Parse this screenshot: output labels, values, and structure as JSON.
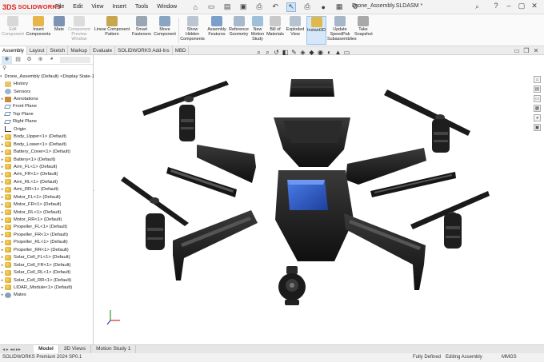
{
  "app": {
    "logo_prefix": "3DS",
    "logo_text": "SOLIDWORKS",
    "document_title": "Drone_Assembly.SLDASM *"
  },
  "menu": [
    "File",
    "Edit",
    "View",
    "Insert",
    "Tools",
    "Window"
  ],
  "ribbon": [
    {
      "label": "Edit Component",
      "disabled": true
    },
    {
      "label": "Insert Components"
    },
    {
      "label": "Mate"
    },
    {
      "label": "Component Preview Window",
      "disabled": true
    },
    {
      "label": "Linear Component Pattern"
    },
    {
      "label": "Smart Fasteners"
    },
    {
      "label": "Move Component"
    },
    {
      "label": "Show Hidden Components"
    },
    {
      "label": "Assembly Features"
    },
    {
      "label": "Reference Geometry"
    },
    {
      "label": "New Motion Study"
    },
    {
      "label": "Bill of Materials"
    },
    {
      "label": "Exploded View"
    },
    {
      "label": "Instant3D",
      "active": true
    },
    {
      "label": "Update SpeedPak Subassemblies"
    },
    {
      "label": "Take Snapshot"
    }
  ],
  "command_tabs": [
    "Assembly",
    "Layout",
    "Sketch",
    "Markup",
    "Evaluate",
    "SOLIDWORKS Add-Ins",
    "MBD"
  ],
  "active_command_tab": "Assembly",
  "tree": {
    "root": "Drone_Assembly (Default) <Display State-1>",
    "items": [
      {
        "label": "History",
        "icon": "folder"
      },
      {
        "label": "Sensors",
        "icon": "sensor"
      },
      {
        "label": "Annotations",
        "icon": "anno",
        "expand": true
      },
      {
        "label": "Front Plane",
        "icon": "plane"
      },
      {
        "label": "Top Plane",
        "icon": "plane"
      },
      {
        "label": "Right Plane",
        "icon": "plane"
      },
      {
        "label": "Origin",
        "icon": "origin"
      },
      {
        "label": "Body_Upper<1> (Default)",
        "icon": "part",
        "expand": true
      },
      {
        "label": "Body_Lower<1> (Default)",
        "icon": "part",
        "expand": true
      },
      {
        "label": "Battery_Cover<1> (Default)",
        "icon": "part",
        "expand": true
      },
      {
        "label": "Battery<1> (Default)",
        "icon": "part",
        "expand": true
      },
      {
        "label": "Arm_FL<1> (Default)",
        "icon": "part",
        "expand": true
      },
      {
        "label": "Arm_FR<1> (Default)",
        "icon": "part",
        "expand": true
      },
      {
        "label": "Arm_RL<1> (Default)",
        "icon": "part",
        "expand": true
      },
      {
        "label": "Arm_RR<1> (Default)",
        "icon": "part",
        "expand": true
      },
      {
        "label": "Motor_FL<1> (Default)",
        "icon": "part",
        "expand": true
      },
      {
        "label": "Motor_FR<1> (Default)",
        "icon": "part",
        "expand": true
      },
      {
        "label": "Motor_RL<1> (Default)",
        "icon": "part",
        "expand": true
      },
      {
        "label": "Motor_RR<1> (Default)",
        "icon": "part",
        "expand": true
      },
      {
        "label": "Propeller_FL<1> (Default)",
        "icon": "part",
        "expand": true
      },
      {
        "label": "Propeller_FR<1> (Default)",
        "icon": "part",
        "expand": true
      },
      {
        "label": "Propeller_RL<1> (Default)",
        "icon": "part",
        "expand": true
      },
      {
        "label": "Propeller_RR<1> (Default)",
        "icon": "part",
        "expand": true
      },
      {
        "label": "Solar_Cell_FL<1> (Default)",
        "icon": "part",
        "expand": true
      },
      {
        "label": "Solar_Cell_FR<1> (Default)",
        "icon": "part",
        "expand": true
      },
      {
        "label": "Solar_Cell_RL<1> (Default)",
        "icon": "part",
        "expand": true
      },
      {
        "label": "Solar_Cell_RR<1> (Default)",
        "icon": "part",
        "expand": true
      },
      {
        "label": "LIDAR_Module<1> (Default)",
        "icon": "part",
        "expand": true
      },
      {
        "label": "Mates",
        "icon": "mate",
        "expand": true
      }
    ]
  },
  "bottom_tabs": [
    "Model",
    "3D Views",
    "Motion Study 1"
  ],
  "active_bottom_tab": "Model",
  "status": {
    "version": "SOLIDWORKS Premium 2024 SP0.1",
    "defined": "Fully Defined",
    "mode": "Editing Assembly",
    "units": "MMGS"
  },
  "colors": {
    "brand": "#d9241c",
    "battery": "#2b5fcf",
    "part": "#1c1c1c",
    "solar": "#6b6b6b"
  }
}
